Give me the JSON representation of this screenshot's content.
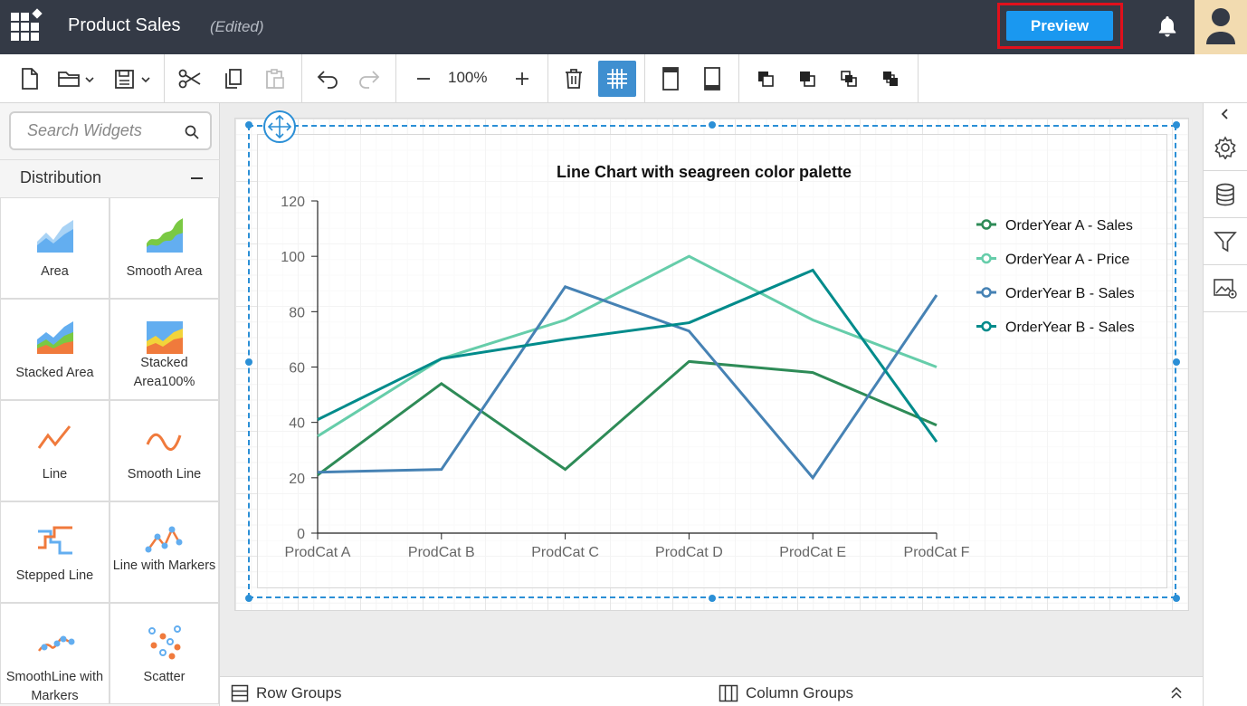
{
  "header": {
    "title": "Product Sales",
    "status": "(Edited)",
    "preview_label": "Preview"
  },
  "toolbar": {
    "zoom": "100%"
  },
  "sidebar": {
    "search_placeholder": "Search Widgets",
    "category": "Distribution",
    "widgets": [
      {
        "label": "Area"
      },
      {
        "label": "Smooth Area"
      },
      {
        "label": "Stacked Area"
      },
      {
        "label": "Stacked Area100%"
      },
      {
        "label": "Line"
      },
      {
        "label": "Smooth Line"
      },
      {
        "label": "Stepped Line"
      },
      {
        "label": "Line with Markers"
      },
      {
        "label": "SmoothLine with Markers"
      },
      {
        "label": "Scatter"
      }
    ]
  },
  "bottom": {
    "row_groups": "Row Groups",
    "column_groups": "Column Groups"
  },
  "colors": {
    "topbar": "#343a46",
    "accent": "#1a98f0",
    "highlight": "#e0101c"
  },
  "chart_data": {
    "type": "line",
    "title": "Line Chart with seagreen color palette",
    "categories": [
      "ProdCat A",
      "ProdCat B",
      "ProdCat C",
      "ProdCat D",
      "ProdCat E",
      "ProdCat F"
    ],
    "ylim": [
      0,
      120
    ],
    "yticks": [
      0,
      20,
      40,
      60,
      80,
      100,
      120
    ],
    "grid": false,
    "legend_position": "right",
    "series": [
      {
        "name": "OrderYear A - Sales",
        "color": "#2e8b57",
        "values": [
          21,
          54,
          23,
          62,
          58,
          39
        ]
      },
      {
        "name": "OrderYear A - Price",
        "color": "#66cdaa",
        "values": [
          35,
          63,
          77,
          100,
          77,
          60
        ]
      },
      {
        "name": "OrderYear B - Sales",
        "color": "#4682b4",
        "values": [
          22,
          23,
          89,
          73,
          20,
          86
        ]
      },
      {
        "name": "OrderYear B - Sales",
        "color": "#008b8b",
        "values": [
          41,
          63,
          70,
          76,
          95,
          33
        ]
      }
    ]
  }
}
